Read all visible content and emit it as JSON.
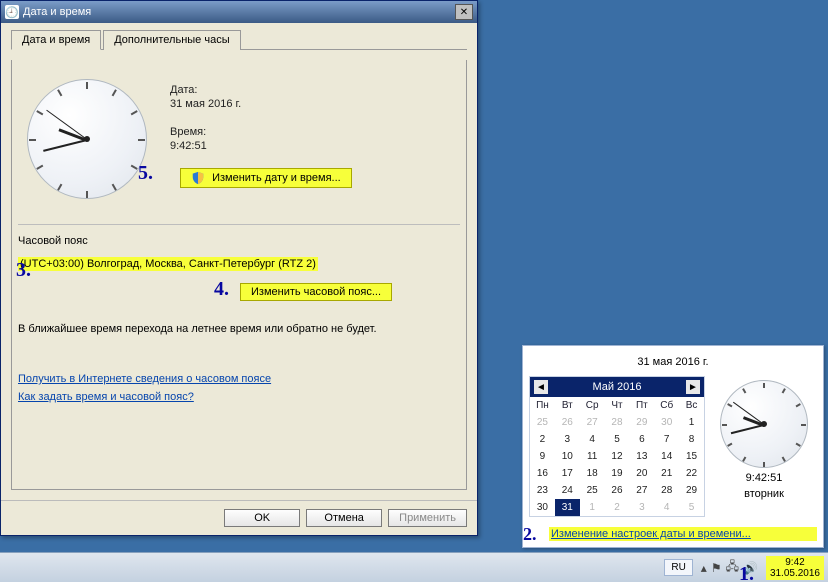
{
  "dialog": {
    "title": "Дата и время",
    "tabs": {
      "datetime": "Дата и время",
      "additional": "Дополнительные часы"
    },
    "date_label": "Дата:",
    "date_value": "31 мая 2016 г.",
    "time_label": "Время:",
    "time_value": "9:42:51",
    "change_dt_btn": "Изменить дату и время...",
    "tz_section": "Часовой пояс",
    "tz_value": "(UTC+03:00) Волгоград, Москва, Санкт-Петербург (RTZ 2)",
    "change_tz_btn": "Изменить часовой пояс...",
    "dst_note": "В ближайшее время перехода на летнее время или обратно не будет.",
    "link1": "Получить в Интернете сведения о часовом поясе",
    "link2": "Как задать время и часовой пояс?",
    "ok": "OK",
    "cancel": "Отмена",
    "apply": "Применить"
  },
  "annot": {
    "n3": "3.",
    "n4": "4.",
    "n5": "5.",
    "n2": "2.",
    "n1": "1."
  },
  "tray_popup": {
    "header_date": "31 мая 2016 г.",
    "month_label": "Май 2016",
    "dayheads": [
      "Пн",
      "Вт",
      "Ср",
      "Чт",
      "Пт",
      "Сб",
      "Вс"
    ],
    "days": [
      {
        "n": 25,
        "o": true
      },
      {
        "n": 26,
        "o": true
      },
      {
        "n": 27,
        "o": true
      },
      {
        "n": 28,
        "o": true
      },
      {
        "n": 29,
        "o": true
      },
      {
        "n": 30,
        "o": true
      },
      {
        "n": 1
      },
      {
        "n": 2
      },
      {
        "n": 3
      },
      {
        "n": 4
      },
      {
        "n": 5
      },
      {
        "n": 6
      },
      {
        "n": 7
      },
      {
        "n": 8
      },
      {
        "n": 9
      },
      {
        "n": 10
      },
      {
        "n": 11
      },
      {
        "n": 12
      },
      {
        "n": 13
      },
      {
        "n": 14
      },
      {
        "n": 15
      },
      {
        "n": 16
      },
      {
        "n": 17
      },
      {
        "n": 18
      },
      {
        "n": 19
      },
      {
        "n": 20
      },
      {
        "n": 21
      },
      {
        "n": 22
      },
      {
        "n": 23
      },
      {
        "n": 24
      },
      {
        "n": 25
      },
      {
        "n": 26
      },
      {
        "n": 27
      },
      {
        "n": 28
      },
      {
        "n": 29
      },
      {
        "n": 30
      },
      {
        "n": 31,
        "t": true
      },
      {
        "n": 1,
        "o": true
      },
      {
        "n": 2,
        "o": true
      },
      {
        "n": 3,
        "o": true
      },
      {
        "n": 4,
        "o": true
      },
      {
        "n": 5,
        "o": true
      }
    ],
    "time_value": "9:42:51",
    "weekday": "вторник",
    "change_link": "Изменение настроек даты и времени..."
  },
  "taskbar": {
    "lang": "RU",
    "clock_time": "9:42",
    "clock_date": "31.05.2016"
  },
  "clock": {
    "hour_angle": 201,
    "min_angle": 166,
    "sec_angle": 216
  }
}
